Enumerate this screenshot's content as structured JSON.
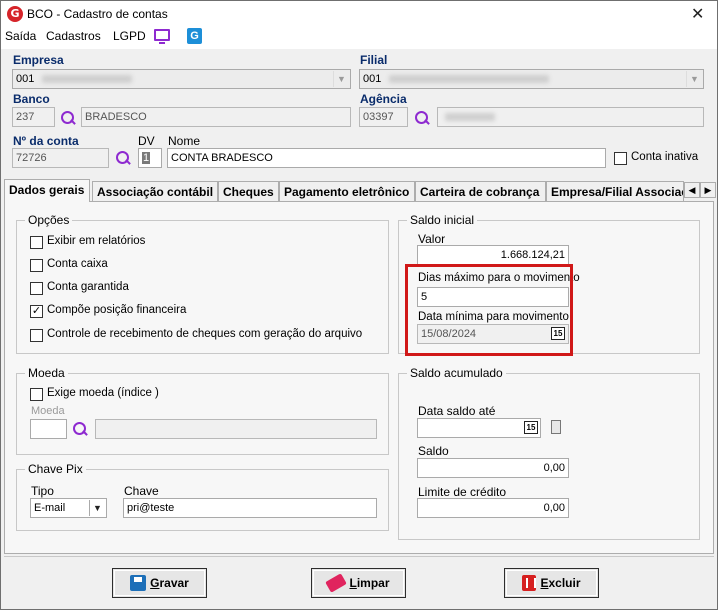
{
  "window": {
    "title": "BCO - Cadastro de contas",
    "app_icon_letter": "G",
    "close_glyph": "✕"
  },
  "menu": {
    "items": [
      "Saída",
      "Cadastros",
      "LGPD"
    ],
    "g_icon_letter": "G"
  },
  "form": {
    "empresa": {
      "label": "Empresa",
      "value": "001"
    },
    "filial": {
      "label": "Filial",
      "value": "001"
    },
    "banco": {
      "label": "Banco",
      "code": "237",
      "name": "BRADESCO"
    },
    "agencia": {
      "label": "Agência",
      "code": "03397"
    },
    "conta": {
      "label": "Nº da conta",
      "value": "72726"
    },
    "dv": {
      "label": "DV",
      "value": "1"
    },
    "nome": {
      "label": "Nome",
      "value": "CONTA BRADESCO"
    },
    "conta_inativa": {
      "label": "Conta inativa",
      "checked": false
    }
  },
  "tabs": [
    "Dados gerais",
    "Associação contábil",
    "Cheques",
    "Pagamento eletrônico",
    "Carteira de cobrança",
    "Empresa/Filial Associac"
  ],
  "tab_scroll": {
    "left": "◀",
    "right": "▶"
  },
  "opcoes": {
    "title": "Opções",
    "items": [
      {
        "label": "Exibir em relatórios",
        "checked": false
      },
      {
        "label": "Conta caixa",
        "checked": false
      },
      {
        "label": "Conta garantida",
        "checked": false
      },
      {
        "label": "Compõe posição financeira",
        "checked": true
      },
      {
        "label": "Controle de recebimento de cheques com geração do arquivo",
        "checked": false
      }
    ]
  },
  "moeda": {
    "title": "Moeda",
    "exige_label": "Exige moeda (índice )",
    "exige_checked": false,
    "moeda_label": "Moeda",
    "moeda_code": "",
    "moeda_name": ""
  },
  "chave_pix": {
    "title": "Chave Pix",
    "tipo_label": "Tipo",
    "tipo_value": "E-mail",
    "chave_label": "Chave",
    "chave_value": "pri@teste"
  },
  "saldo_inicial": {
    "title": "Saldo inicial",
    "valor_label": "Valor",
    "valor": "1.668.124,21",
    "dias_label": "Dias máximo para o movimento",
    "dias_value": "5",
    "data_min_label": "Data mínima para movimento",
    "data_min_value": "15/08/2024",
    "calendar_glyph": "15"
  },
  "saldo_acumulado": {
    "title": "Saldo acumulado",
    "data_label": "Data saldo até",
    "data_value": " /  /",
    "calendar_glyph": "15",
    "saldo_label": "Saldo",
    "saldo_value": "0,00",
    "limite_label": "Limite de crédito",
    "limite_value": "0,00"
  },
  "buttons": {
    "gravar": {
      "prefix": "G",
      "rest": "ravar"
    },
    "limpar": {
      "prefix": "L",
      "rest": "impar"
    },
    "excluir": {
      "prefix": "E",
      "rest": "xcluir"
    }
  },
  "colors": {
    "accent_purple": "#8e2ad0",
    "label_navy": "#0a2c6b",
    "highlight_red": "#d01818"
  }
}
